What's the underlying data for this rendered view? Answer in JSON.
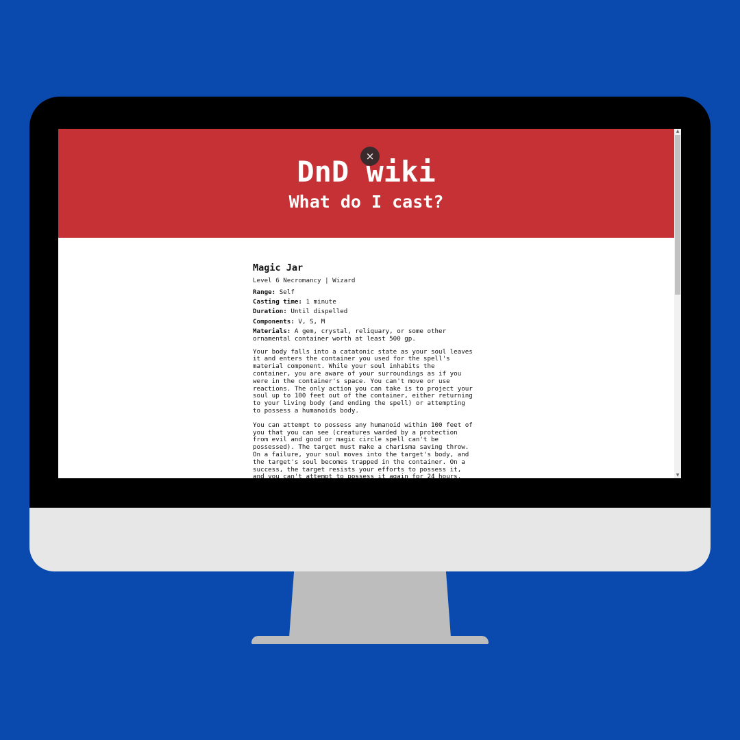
{
  "header": {
    "title": "DnD wiki",
    "subtitle": "What do I cast?",
    "close_glyph": "×"
  },
  "spell": {
    "name": "Magic Jar",
    "meta": "Level 6 Necromancy | Wizard",
    "range_label": "Range:",
    "range": "Self",
    "casting_time_label": "Casting time:",
    "casting_time": "1 minute",
    "duration_label": "Duration:",
    "duration": "Until dispelled",
    "components_label": "Components:",
    "components": "V, S, M",
    "materials_label": "Materials:",
    "materials": "A gem, crystal, reliquary, or some other ornamental container worth at least 500 gp.",
    "description_1": "Your body falls into a catatonic state as your soul leaves it and enters the container you used for the spell's material component. While your soul inhabits the container, you are aware of your surroundings as if you were in the container's space. You can't move or use reactions. The only action you can take is to project your soul up to 100 feet out of the container, either returning to your living body (and ending the spell) or attempting to possess a humanoids body.",
    "description_2": "You can attempt to possess any humanoid within 100 feet of you that you can see (creatures warded by a protection from evil and good or magic circle spell can't be possessed). The target must make a charisma saving throw. On a failure, your soul moves into the target's body, and the target's soul becomes trapped in the container. On a success, the target resists your efforts to possess it, and you can't attempt to possess it again for 24 hours."
  },
  "scrollbar": {
    "up_glyph": "▲",
    "down_glyph": "▼"
  },
  "colors": {
    "background": "#0a4aae",
    "header": "#c53135",
    "bezel": "#000000",
    "chin": "#e7e7e7",
    "stand": "#bdbdbd"
  }
}
